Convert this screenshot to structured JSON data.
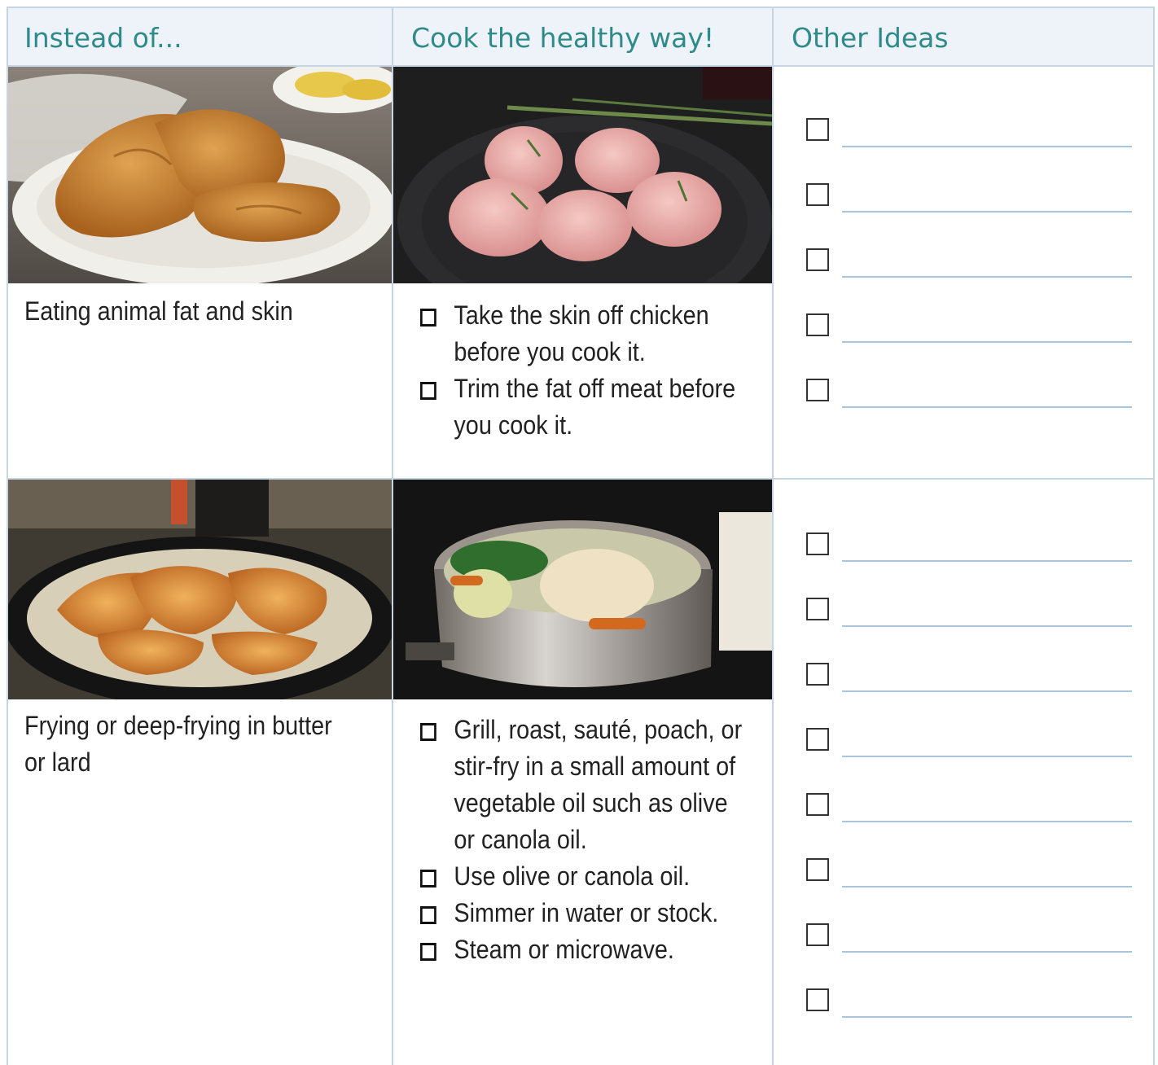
{
  "headers": {
    "instead_of": "Instead of...",
    "cook_healthy": "Cook the healthy way!",
    "other_ideas": "Other Ideas"
  },
  "rows": [
    {
      "photo_unhealthy": "fried-chicken-plate-photo",
      "photo_healthy": "raw-skinless-chicken-photo",
      "instead_label": "Eating animal fat and skin",
      "tips": [
        "Take the skin off chicken before you cook it.",
        "Trim the fat off meat before you cook it."
      ],
      "idea_slots": 5
    },
    {
      "photo_unhealthy": "pan-fried-chicken-photo",
      "photo_healthy": "poached-chicken-pot-photo",
      "instead_label": "Frying or deep-frying in butter or lard",
      "tips": [
        "Grill, roast, sauté, poach, or stir-fry in a small amount of vegetable oil such as olive or canola oil.",
        "Use olive or canola oil.",
        "Simmer in water or stock.",
        "Steam or microwave."
      ],
      "idea_slots": 8
    }
  ],
  "colors": {
    "header_text": "#2f8a8a",
    "header_bg": "#eef3f9",
    "grid": "#c6d5e4",
    "write_line": "#a9c4dc"
  }
}
